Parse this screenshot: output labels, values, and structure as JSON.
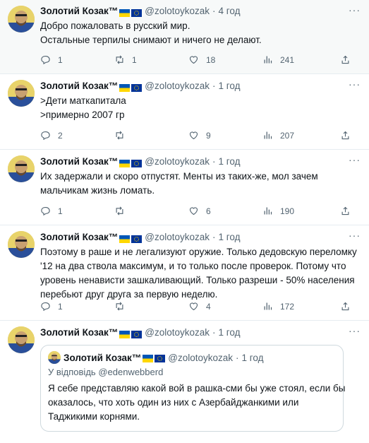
{
  "author": {
    "name": "Золотий Козак™",
    "handle": "@zolotoykozak"
  },
  "colors": {
    "flag_blue": "#0057b7",
    "flag_yellow": "#ffd700",
    "eu_blue": "#003399"
  },
  "tweets": [
    {
      "time": "4 год",
      "lines": [
        "Добро пожаловать в русский мир.",
        "Остальные терпилы снимают и ничего не делают."
      ],
      "replies": "1",
      "retweets": "1",
      "likes": "18",
      "views": "241"
    },
    {
      "time": "1 год",
      "lines": [
        ">Дети маткапитала",
        ">примерно 2007 гр"
      ],
      "replies": "2",
      "retweets": "",
      "likes": "9",
      "views": "207"
    },
    {
      "time": "1 год",
      "lines": [
        "Их задержали и скоро отпустят. Менты из таких-же, мол зачем",
        "мальчикам жизнь ломать."
      ],
      "replies": "1",
      "retweets": "",
      "likes": "6",
      "views": "190"
    },
    {
      "time": "1 год",
      "lines": [
        "Поэтому в раше и не легализуют оружие. Только дедовскую переломку",
        "'12 на два ствола максимум, и то только после проверок. Потому что",
        "уровень ненависти зашкаливающий. Только разреши - 50% населения",
        "перебьют друг друга за первую неделю."
      ],
      "replies": "1",
      "retweets": "",
      "likes": "4",
      "views": "172"
    },
    {
      "time": "1 год",
      "quote": {
        "time": "1 год",
        "replying_label": "У відповідь",
        "replying_to": "@edenwebberd",
        "lines": [
          "Я себе представляю какой вой в рашка-сми бы уже стоял, если бы",
          "оказалось, что хоть один из них с Азербайджанкими или",
          "Таджикими корнями."
        ]
      }
    }
  ]
}
